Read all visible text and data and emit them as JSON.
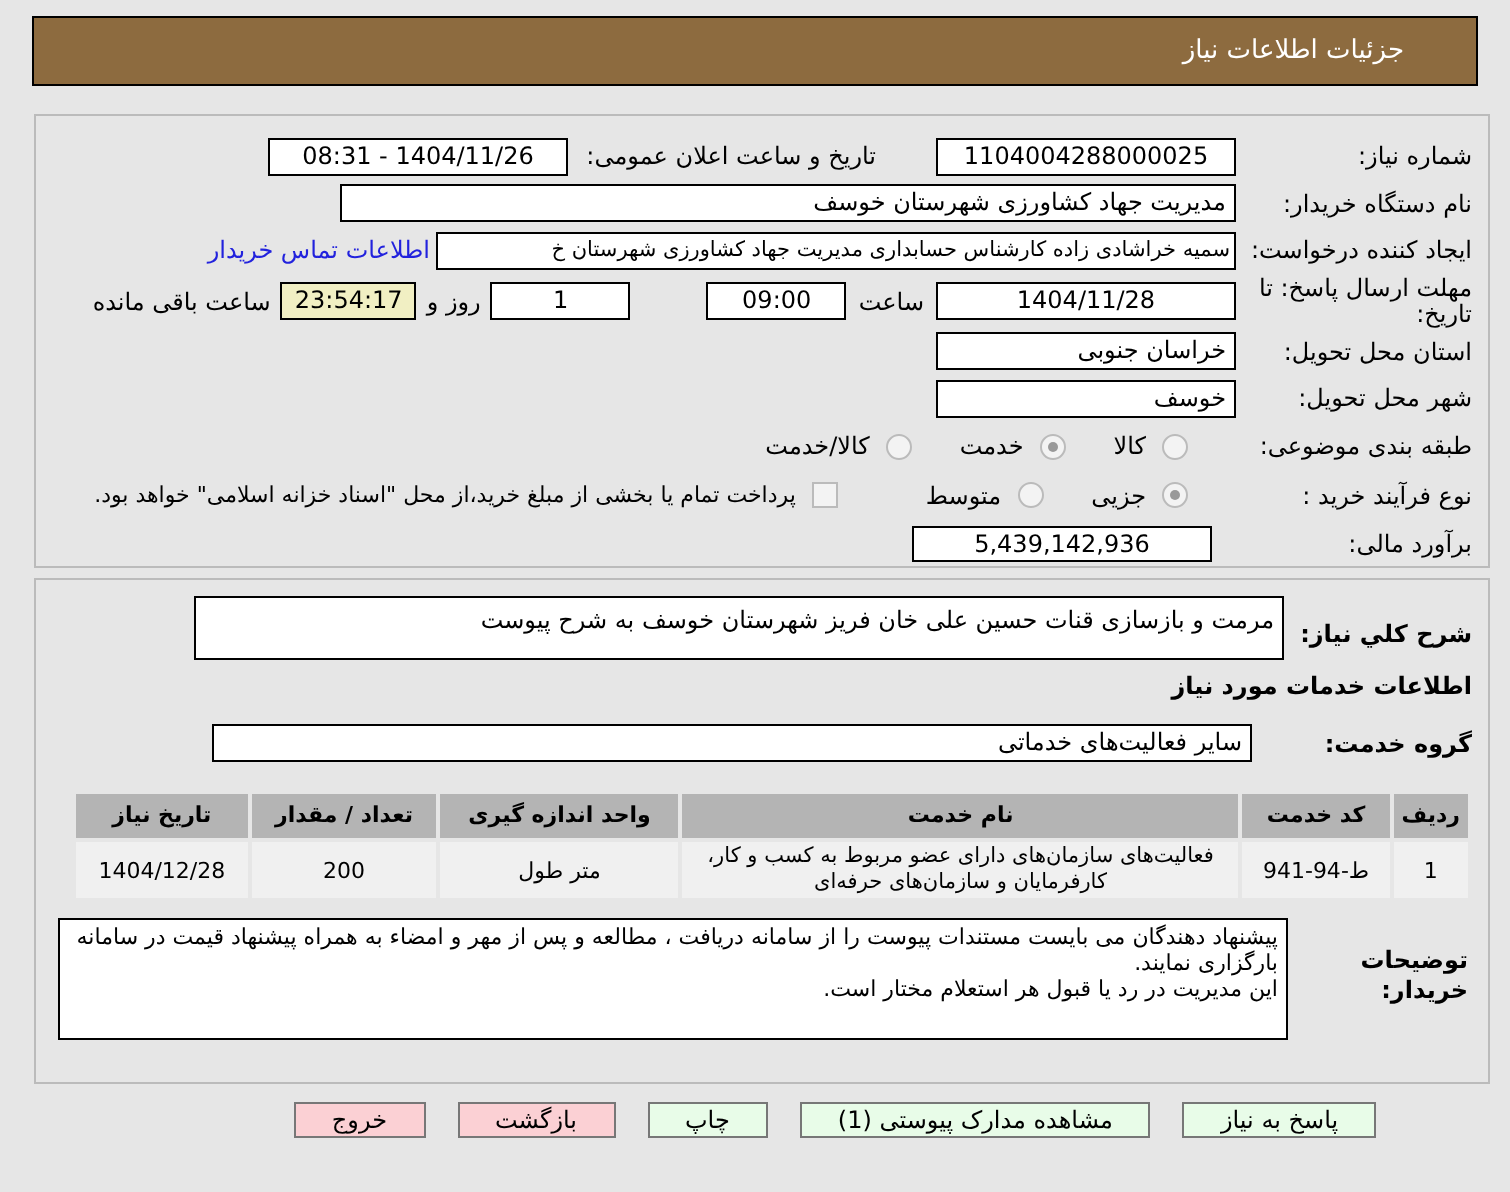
{
  "header": {
    "title": "جزئیات اطلاعات نیاز"
  },
  "need_number": {
    "label": "شماره نیاز:",
    "value": "1104004288000025"
  },
  "announce": {
    "label": "تاریخ و ساعت اعلان عمومی:",
    "value": "1404/11/26 - 08:31"
  },
  "buyer_org": {
    "label": "نام دستگاه خریدار:",
    "value": "مدیریت جهاد کشاورزی شهرستان خوسف"
  },
  "creator": {
    "label": "ایجاد کننده درخواست:",
    "value": "سمیه خراشادی زاده کارشناس حسابداری مدیریت جهاد کشاورزی شهرستان خ",
    "link": "اطلاعات تماس خریدار"
  },
  "deadline": {
    "label": "مهلت ارسال پاسخ: تا تاریخ:",
    "date": "1404/11/28",
    "time_label": "ساعت",
    "time": "09:00",
    "days": "1",
    "days_label": "روز و",
    "remaining": "23:54:17",
    "remaining_label": "ساعت باقی مانده"
  },
  "province": {
    "label": "استان محل تحویل:",
    "value": "خراسان جنوبی"
  },
  "city": {
    "label": "شهر محل تحویل:",
    "value": "خوسف"
  },
  "category": {
    "label": "طبقه بندی موضوعی:",
    "options": [
      {
        "label": "کالا",
        "selected": false
      },
      {
        "label": "خدمت",
        "selected": true
      },
      {
        "label": "کالا/خدمت",
        "selected": false
      }
    ]
  },
  "purchase_type": {
    "label": "نوع فرآیند خرید :",
    "options": [
      {
        "label": "جزیی",
        "selected": true
      },
      {
        "label": "متوسط",
        "selected": false
      }
    ],
    "payment": {
      "label": "پرداخت تمام یا بخشی از مبلغ خرید،از محل \"اسناد خزانه اسلامی\" خواهد بود.",
      "checked": false
    }
  },
  "budget": {
    "label": "برآورد مالی:",
    "value": "5,439,142,936"
  },
  "summary": {
    "label": "شرح کلي نياز:",
    "value": "مرمت و بازسازی قنات حسین علی خان فریز شهرستان خوسف به شرح پیوست"
  },
  "services_title": "اطلاعات خدمات مورد نياز",
  "service_group": {
    "label": "گروه خدمت:",
    "value": "سایر فعالیت‌های خدماتی"
  },
  "table": {
    "columns": [
      "ردیف",
      "کد خدمت",
      "نام خدمت",
      "واحد اندازه گیری",
      "تعداد / مقدار",
      "تاریخ نیاز"
    ],
    "rows": [
      [
        "1",
        "ط-94-941",
        "فعالیت‌های سازمان‌های دارای عضو مربوط به کسب و کار، کارفرمایان و سازمان‌های حرفه‌ای",
        "متر طول",
        "200",
        "1404/12/28"
      ]
    ]
  },
  "buyer_notes": {
    "label": "توضیحات خریدار:",
    "lines": [
      "پیشنهاد دهندگان می بایست مستندات پیوست را از سامانه دریافت ، مطالعه و پس از مهر و امضاء به همراه پیشنهاد قیمت در سامانه بارگزاری نمایند.",
      "این مدیریت در رد یا قبول هر استعلام مختار است."
    ]
  },
  "buttons": [
    {
      "label": "پاسخ به نیاز",
      "kind": "primary"
    },
    {
      "label": "مشاهده مدارک پیوستی (1)",
      "kind": "primary"
    },
    {
      "label": "چاپ",
      "kind": "primary"
    },
    {
      "label": "بازگشت",
      "kind": "danger"
    },
    {
      "label": "خروج",
      "kind": "danger"
    }
  ]
}
